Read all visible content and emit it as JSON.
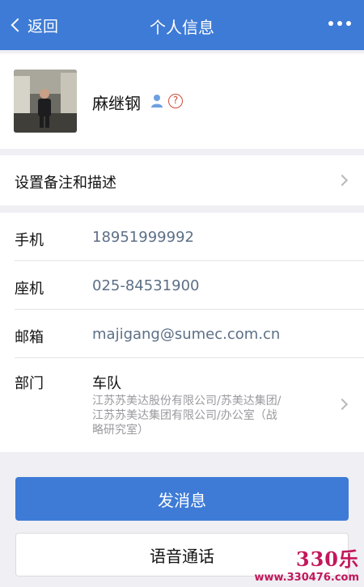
{
  "header": {
    "back_label": "返回",
    "title": "个人信息",
    "more_icon": "more-dots-icon",
    "bg_color": "#3e7bd6"
  },
  "profile": {
    "name": "麻继钢",
    "badges": [
      "person-icon",
      "help-icon"
    ],
    "help_glyph": "?"
  },
  "remark": {
    "label": "设置备注和描述"
  },
  "info": {
    "phone": {
      "label": "手机",
      "value": "18951999992"
    },
    "landline": {
      "label": "座机",
      "value": "025-84531900"
    },
    "email": {
      "label": "邮箱",
      "value": "majigang@sumec.com.cn"
    },
    "department": {
      "label": "部门",
      "name": "车队",
      "path_lines": [
        "江苏苏美达股份有限公司/苏美达集团/",
        "江苏苏美达集团有限公司/办公室（战",
        "略研究室）"
      ]
    }
  },
  "actions": {
    "send_message": "发消息",
    "voice_call": "语音通话"
  },
  "watermark": {
    "logo_text": "330乐",
    "url": "www.330476.com"
  }
}
